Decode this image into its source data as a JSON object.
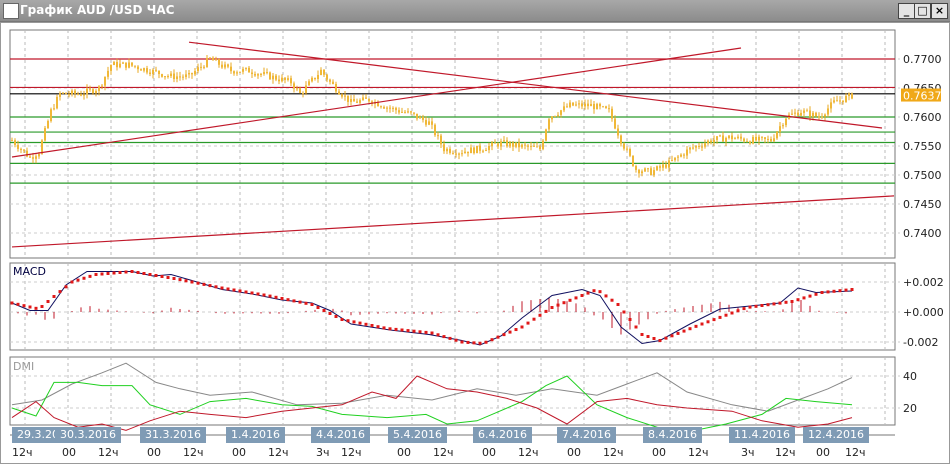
{
  "window": {
    "title": "График AUD /USD  ЧАС",
    "min": "_",
    "max": "□",
    "close": "×"
  },
  "chart_data": {
    "type": "candlestick",
    "symbol": "AUD/USD",
    "timeframe": "ЧАС",
    "price_axis": {
      "ticks": [
        "0.7700",
        "0.7650",
        "0.7600",
        "0.7550",
        "0.7500",
        "0.7450",
        "0.7400"
      ],
      "ylim": [
        0.7365,
        0.7755
      ]
    },
    "current_price": "0.7637",
    "price_path": [
      [
        0,
        0.756
      ],
      [
        6,
        0.753
      ],
      [
        9,
        0.754
      ],
      [
        13,
        0.761
      ],
      [
        16,
        0.764
      ],
      [
        23,
        0.764
      ],
      [
        29,
        0.765
      ],
      [
        33,
        0.769
      ],
      [
        39,
        0.769
      ],
      [
        46,
        0.768
      ],
      [
        53,
        0.767
      ],
      [
        59,
        0.767
      ],
      [
        66,
        0.77
      ],
      [
        73,
        0.768
      ],
      [
        79,
        0.768
      ],
      [
        86,
        0.767
      ],
      [
        93,
        0.766
      ],
      [
        96,
        0.764
      ],
      [
        103,
        0.768
      ],
      [
        106,
        0.766
      ],
      [
        113,
        0.7625
      ],
      [
        119,
        0.763
      ],
      [
        126,
        0.7615
      ],
      [
        133,
        0.7605
      ],
      [
        139,
        0.759
      ],
      [
        144,
        0.7545
      ],
      [
        149,
        0.754
      ],
      [
        156,
        0.7545
      ],
      [
        163,
        0.7555
      ],
      [
        169,
        0.755
      ],
      [
        176,
        0.7545
      ],
      [
        179,
        0.76
      ],
      [
        186,
        0.762
      ],
      [
        193,
        0.762
      ],
      [
        199,
        0.761
      ],
      [
        203,
        0.756
      ],
      [
        208,
        0.751
      ],
      [
        213,
        0.7505
      ],
      [
        219,
        0.752
      ],
      [
        226,
        0.7545
      ],
      [
        233,
        0.756
      ],
      [
        239,
        0.7565
      ],
      [
        246,
        0.756
      ],
      [
        253,
        0.756
      ],
      [
        258,
        0.76
      ],
      [
        263,
        0.761
      ],
      [
        269,
        0.76
      ],
      [
        274,
        0.7625
      ],
      [
        280,
        0.7637
      ]
    ],
    "levels": [
      {
        "price": 0.77,
        "color": "#c0182a"
      },
      {
        "price": 0.7651,
        "color": "#c0182a"
      },
      {
        "price": 0.764,
        "color": "#000000"
      },
      {
        "price": 0.76,
        "color": "#2a9a2a"
      },
      {
        "price": 0.7574,
        "color": "#2a9a2a"
      },
      {
        "price": 0.7556,
        "color": "#2a9a2a"
      },
      {
        "price": 0.752,
        "color": "#2a9a2a"
      },
      {
        "price": 0.7486,
        "color": "#2a9a2a"
      }
    ],
    "trendlines": [
      {
        "from": [
          59,
          0.7729
        ],
        "to": [
          290,
          0.7581
        ]
      },
      {
        "from": [
          0,
          0.7531
        ],
        "to": [
          243,
          0.7719
        ]
      },
      {
        "from": [
          0,
          0.7376
        ],
        "to": [
          294,
          0.7464
        ]
      }
    ],
    "macd": {
      "label": "MACD",
      "ticks": [
        "+0.002",
        "+0.000",
        "-0.002"
      ],
      "macd": [
        [
          0,
          0.0006
        ],
        [
          6,
          0.0001
        ],
        [
          12,
          0.0001
        ],
        [
          18,
          0.0018
        ],
        [
          25,
          0.0027
        ],
        [
          33,
          0.0027
        ],
        [
          40,
          0.0027
        ],
        [
          47,
          0.0024
        ],
        [
          53,
          0.0025
        ],
        [
          60,
          0.0021
        ],
        [
          70,
          0.0015
        ],
        [
          80,
          0.0012
        ],
        [
          90,
          0.0008
        ],
        [
          100,
          0.0006
        ],
        [
          106,
          0.0001
        ],
        [
          113,
          -0.0008
        ],
        [
          126,
          -0.0012
        ],
        [
          139,
          -0.0015
        ],
        [
          150,
          -0.0019
        ],
        [
          156,
          -0.0022
        ],
        [
          163,
          -0.0016
        ],
        [
          170,
          -0.0004
        ],
        [
          180,
          0.0011
        ],
        [
          190,
          0.0015
        ],
        [
          196,
          0.0011
        ],
        [
          203,
          -0.001
        ],
        [
          210,
          -0.0021
        ],
        [
          216,
          -0.0019
        ],
        [
          226,
          -0.0008
        ],
        [
          236,
          0.0002
        ],
        [
          246,
          0.0004
        ],
        [
          256,
          0.0006
        ],
        [
          262,
          0.0016
        ],
        [
          268,
          0.0013
        ],
        [
          280,
          0.0014
        ]
      ],
      "signal": [
        [
          0,
          0.0006
        ],
        [
          9,
          0.0002
        ],
        [
          15,
          0.0012
        ],
        [
          20,
          0.002
        ],
        [
          28,
          0.0025
        ],
        [
          40,
          0.0027
        ],
        [
          46,
          0.0025
        ],
        [
          55,
          0.0022
        ],
        [
          70,
          0.0016
        ],
        [
          85,
          0.0011
        ],
        [
          100,
          0.0005
        ],
        [
          110,
          -0.0005
        ],
        [
          125,
          -0.0011
        ],
        [
          140,
          -0.0014
        ],
        [
          150,
          -0.002
        ],
        [
          157,
          -0.0021
        ],
        [
          170,
          -0.001
        ],
        [
          180,
          0.0003
        ],
        [
          195,
          0.0015
        ],
        [
          202,
          0.0005
        ],
        [
          210,
          -0.0015
        ],
        [
          216,
          -0.0019
        ],
        [
          230,
          -0.0008
        ],
        [
          245,
          0.0003
        ],
        [
          260,
          0.0007
        ],
        [
          270,
          0.0013
        ],
        [
          280,
          0.0015
        ]
      ]
    },
    "dmi": {
      "label": "DMI",
      "ticks": [
        "40",
        "20"
      ],
      "adx": [
        [
          0,
          22
        ],
        [
          10,
          25
        ],
        [
          20,
          35
        ],
        [
          30,
          42
        ],
        [
          38,
          48
        ],
        [
          48,
          36
        ],
        [
          56,
          32
        ],
        [
          66,
          28
        ],
        [
          80,
          30
        ],
        [
          95,
          22
        ],
        [
          110,
          23
        ],
        [
          125,
          28
        ],
        [
          140,
          25
        ],
        [
          155,
          32
        ],
        [
          168,
          28
        ],
        [
          180,
          32
        ],
        [
          195,
          28
        ],
        [
          205,
          35
        ],
        [
          215,
          42
        ],
        [
          225,
          30
        ],
        [
          240,
          22
        ],
        [
          252,
          18
        ],
        [
          262,
          25
        ],
        [
          272,
          32
        ],
        [
          280,
          39
        ]
      ],
      "plus_di": [
        [
          0,
          20
        ],
        [
          8,
          15
        ],
        [
          14,
          36
        ],
        [
          22,
          36
        ],
        [
          30,
          34
        ],
        [
          40,
          34
        ],
        [
          46,
          22
        ],
        [
          56,
          16
        ],
        [
          66,
          24
        ],
        [
          78,
          26
        ],
        [
          90,
          22
        ],
        [
          100,
          21
        ],
        [
          110,
          16
        ],
        [
          125,
          14
        ],
        [
          138,
          16
        ],
        [
          145,
          10
        ],
        [
          155,
          12
        ],
        [
          160,
          16
        ],
        [
          170,
          24
        ],
        [
          178,
          34
        ],
        [
          185,
          40
        ],
        [
          195,
          22
        ],
        [
          205,
          14
        ],
        [
          215,
          8
        ],
        [
          225,
          5
        ],
        [
          238,
          10
        ],
        [
          250,
          16
        ],
        [
          258,
          26
        ],
        [
          268,
          24
        ],
        [
          280,
          22
        ]
      ],
      "minus_di": [
        [
          0,
          14
        ],
        [
          8,
          24
        ],
        [
          14,
          14
        ],
        [
          22,
          8
        ],
        [
          30,
          10
        ],
        [
          38,
          6
        ],
        [
          46,
          12
        ],
        [
          56,
          18
        ],
        [
          66,
          16
        ],
        [
          78,
          14
        ],
        [
          90,
          18
        ],
        [
          100,
          20
        ],
        [
          110,
          22
        ],
        [
          120,
          30
        ],
        [
          128,
          26
        ],
        [
          135,
          40
        ],
        [
          145,
          32
        ],
        [
          155,
          30
        ],
        [
          165,
          26
        ],
        [
          175,
          20
        ],
        [
          185,
          10
        ],
        [
          195,
          24
        ],
        [
          205,
          26
        ],
        [
          215,
          22
        ],
        [
          225,
          20
        ],
        [
          240,
          18
        ],
        [
          250,
          12
        ],
        [
          262,
          8
        ],
        [
          272,
          10
        ],
        [
          280,
          14
        ]
      ]
    },
    "dates": [
      "29.3.2016",
      "30.3.2016",
      "31.3.2016",
      "1.4.2016",
      "4.4.2016",
      "5.4.2016",
      "6.4.2016",
      "7.4.2016",
      "8.4.2016",
      "11.4.2016",
      "12.4.2016"
    ],
    "hours": [
      "12ч",
      "00",
      "12ч",
      "00",
      "12ч",
      "00",
      "12ч",
      "3ч",
      "12ч",
      "00",
      "12ч",
      "00",
      "12ч",
      "00",
      "12ч",
      "00",
      "12ч",
      "3ч",
      "12ч",
      "00",
      "12ч"
    ]
  }
}
